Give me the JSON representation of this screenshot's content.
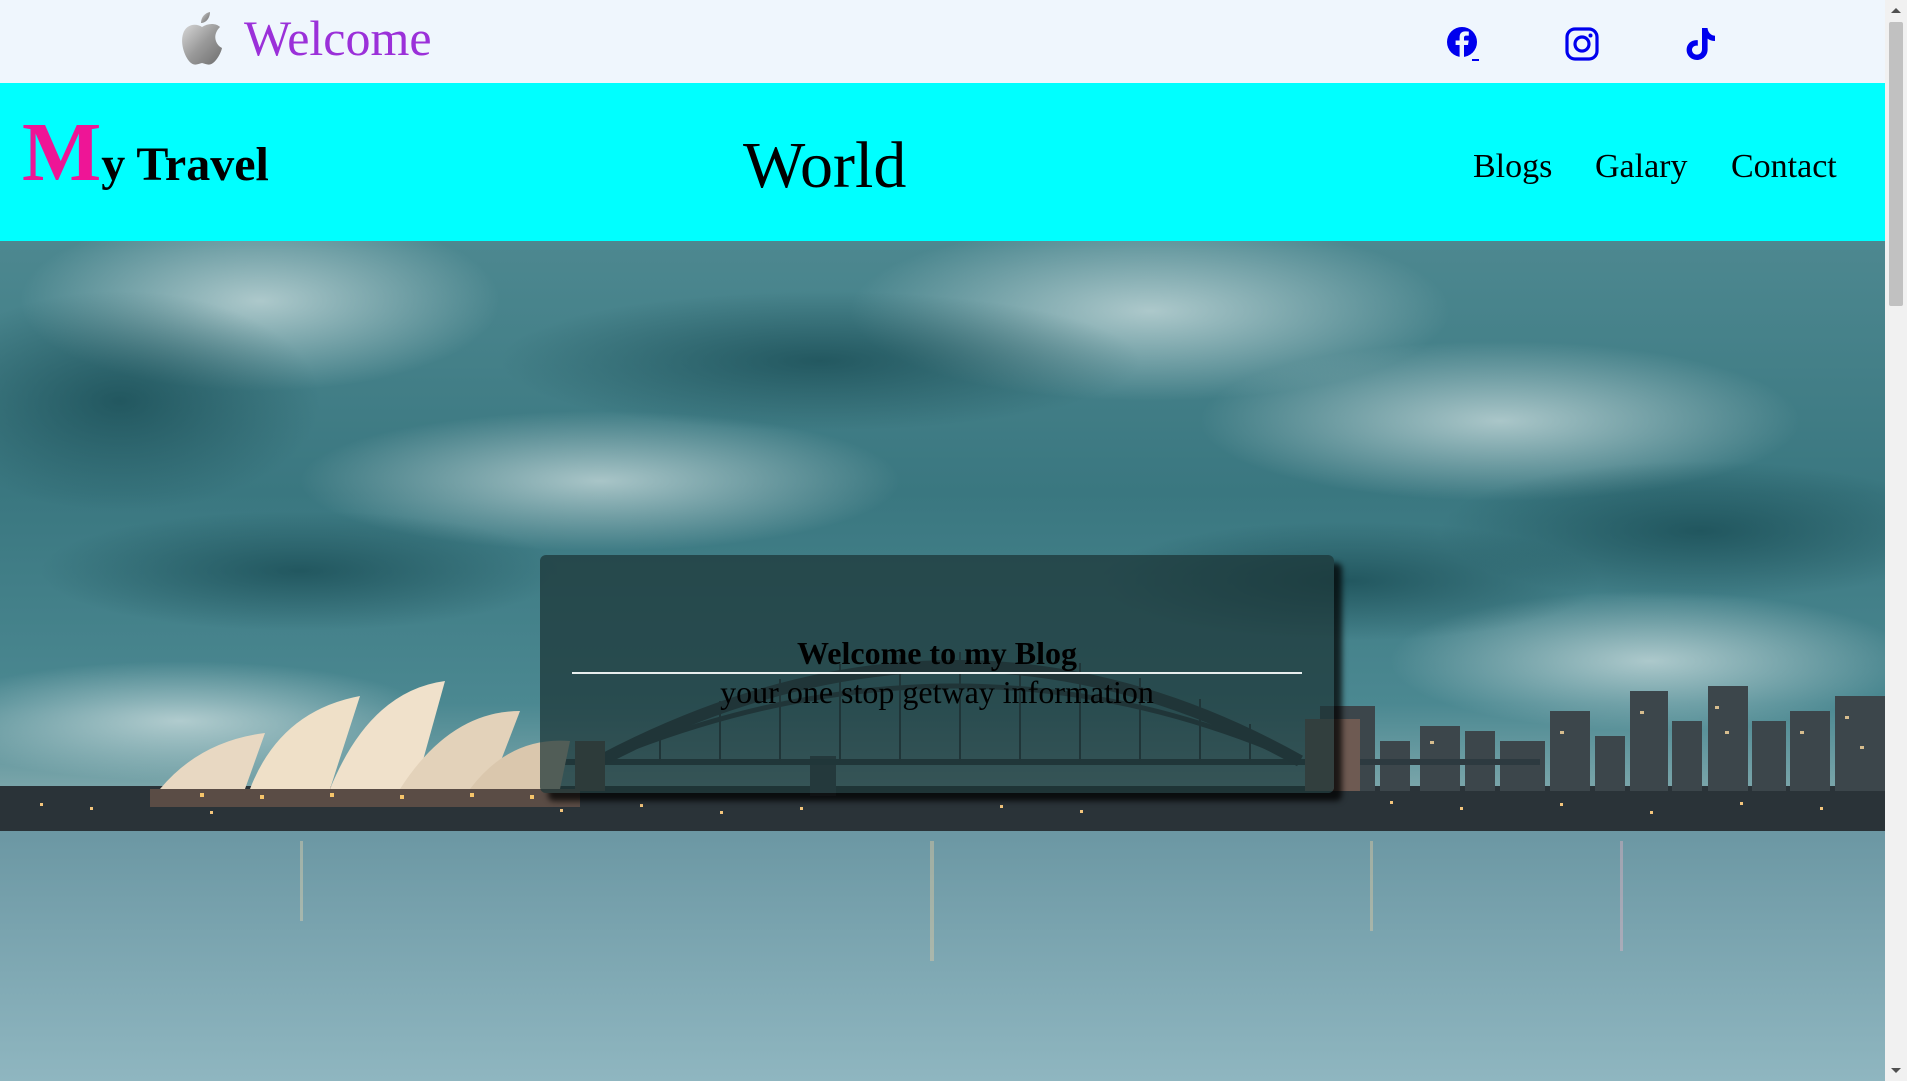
{
  "topbar": {
    "welcome_text": "Welcome",
    "logo_icon": "apple-icon",
    "social_icons": [
      "facebook-icon",
      "instagram-icon",
      "tiktok-icon"
    ],
    "welcome_color": "#9b30d9",
    "icon_color": "#0000ee"
  },
  "nav": {
    "brand_initial": "M",
    "brand_rest": "y Travel",
    "center_title": "World",
    "links": [
      "Blogs",
      "Galary",
      "Contact"
    ],
    "background": "#00ffff",
    "brand_initial_color": "#ee1596"
  },
  "hero": {
    "card_title": "Welcome to my Blog",
    "card_subtitle": "your one stop getway information"
  }
}
